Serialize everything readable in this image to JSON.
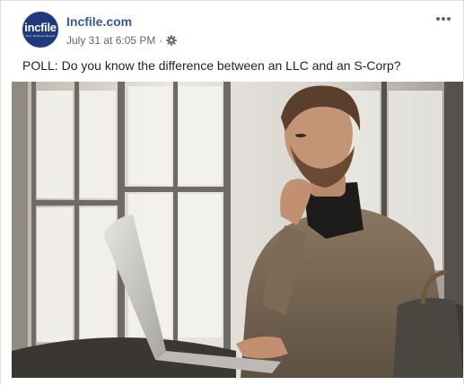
{
  "post": {
    "page_name": "Incfile.com",
    "timestamp": "July 31 at 6:05 PM",
    "separator": "·",
    "text": "POLL: Do you know the difference between an LLC and an S-Corp?"
  },
  "avatar": {
    "logo_text": "incfile",
    "tagline": "Your Business Begins"
  },
  "icons": {
    "privacy": "gear-icon",
    "more": "more-options-icon"
  },
  "colors": {
    "link": "#385898",
    "meta": "#616770",
    "avatar_bg": "#1e3a7b"
  }
}
